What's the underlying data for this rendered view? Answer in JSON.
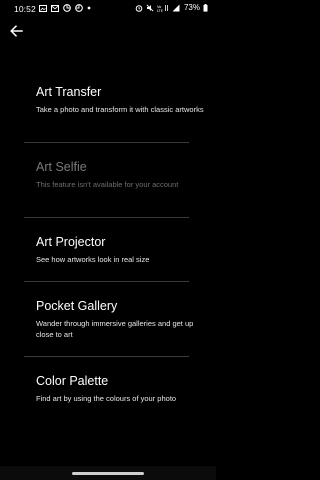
{
  "status_bar": {
    "time": "10:52",
    "battery": "73%",
    "left_icons": [
      "gallery-icon",
      "gmail-icon",
      "pinwheel-icon",
      "pinwheel-icon",
      "dot-icon"
    ],
    "right_icons": [
      "alarm-icon",
      "mute-icon",
      "network-info-icon",
      "signal-icon",
      "battery-icon"
    ],
    "network_label": "VoLTE"
  },
  "header": {
    "back_icon": "arrow-left-icon"
  },
  "items": [
    {
      "title": "Art Transfer",
      "description": "Take a photo and transform it with classic artworks",
      "enabled": true
    },
    {
      "title": "Art Selfie",
      "description": "This feature isn't available for your account",
      "enabled": false
    },
    {
      "title": "Art Projector",
      "description": "See how artworks look in real size",
      "enabled": true
    },
    {
      "title": "Pocket Gallery",
      "description": "Wander through immersive galleries and get up close to art",
      "enabled": true
    },
    {
      "title": "Color Palette",
      "description": "Find art by using the colours of your photo",
      "enabled": true
    }
  ],
  "colors": {
    "background": "#000000",
    "text_primary": "#ffffff",
    "text_disabled": "#7a7a7a",
    "divider": "#3a3a3a"
  }
}
